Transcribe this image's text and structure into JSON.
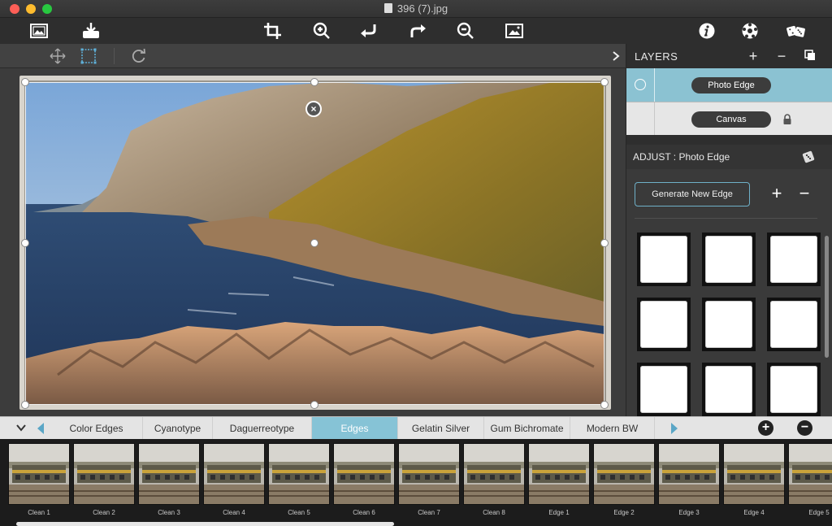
{
  "window": {
    "title": "396 (7).jpg"
  },
  "toolbar": {
    "left": [
      "image-icon",
      "download-icon"
    ],
    "center": [
      "crop-icon",
      "zoom-in-icon",
      "undo-icon",
      "redo-icon",
      "zoom-out-icon",
      "photo-icon"
    ],
    "right": [
      "info-icon",
      "soccer-ball-icon",
      "dice-icon"
    ]
  },
  "subtoolbar": {
    "tools": [
      "move-icon",
      "select-rect-icon",
      "refresh-icon"
    ],
    "expand_icon": "chevron-right-icon"
  },
  "layers": {
    "title": "LAYERS",
    "add": "+",
    "remove": "−",
    "items": [
      {
        "name": "Photo Edge",
        "selected": true
      },
      {
        "name": "Canvas",
        "locked": true
      }
    ]
  },
  "adjust": {
    "title": "ADJUST : Photo Edge",
    "generate_label": "Generate New Edge",
    "add": "+",
    "remove": "−"
  },
  "categories": {
    "tabs": [
      "Color Edges",
      "Cyanotype",
      "Daguerreotype",
      "Edges",
      "Gelatin Silver",
      "Gum Bichromate",
      "Modern BW"
    ],
    "active": "Edges",
    "add": "+",
    "remove": "−"
  },
  "filmstrip": {
    "items": [
      "Clean 1",
      "Clean 2",
      "Clean 3",
      "Clean 4",
      "Clean 5",
      "Clean 6",
      "Clean 7",
      "Clean 8",
      "Edge 1",
      "Edge 2",
      "Edge 3",
      "Edge 4",
      "Edge 5"
    ]
  },
  "colors": {
    "accent": "#86c3d6",
    "layer_selected": "#8bc2d2",
    "generate_border": "#6fb0c8"
  }
}
